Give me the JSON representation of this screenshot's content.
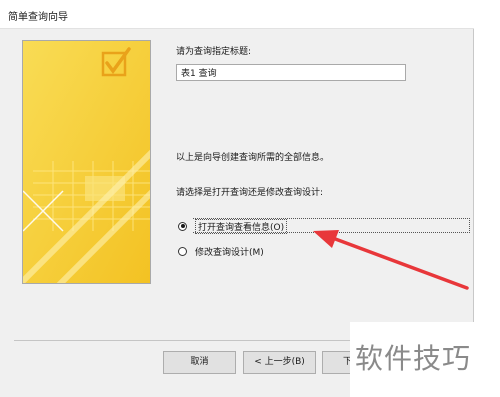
{
  "window": {
    "title": "简单查询向导"
  },
  "form": {
    "title_prompt": "请为查询指定标题:",
    "title_value": "表1 查询",
    "info_text": "以上是向导创建查询所需的全部信息。",
    "choice_prompt": "请选择是打开查询还是修改查询设计:",
    "options": [
      {
        "label": "打开查询查看信息(O)",
        "selected": true
      },
      {
        "label": "修改查询设计(M)",
        "selected": false
      }
    ]
  },
  "buttons": {
    "cancel": "取消",
    "back": "< 上一步(B)",
    "next": "下一"
  },
  "overlay": {
    "watermark": "软件技巧"
  },
  "colors": {
    "annotation_arrow": "#e8373a",
    "art_yellow": "#f7d43f"
  }
}
